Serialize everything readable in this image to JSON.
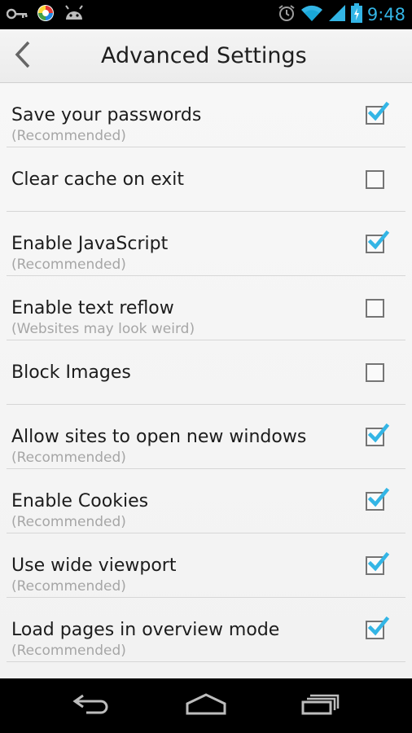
{
  "status_bar": {
    "time": "9:48",
    "icons": [
      "key-icon",
      "app-color-icon",
      "android-icon",
      "alarm-icon",
      "wifi-icon",
      "signal-icon",
      "battery-charging-icon"
    ]
  },
  "header": {
    "title": "Advanced Settings",
    "back_icon": "chevron-left-icon"
  },
  "settings": [
    {
      "label": "Save your passwords",
      "sub": "(Recommended)",
      "checked": true
    },
    {
      "label": "Clear cache on exit",
      "sub": "",
      "checked": false
    },
    {
      "label": "Enable JavaScript",
      "sub": "(Recommended)",
      "checked": true
    },
    {
      "label": "Enable text reflow",
      "sub": "(Websites may look weird)",
      "checked": false
    },
    {
      "label": "Block Images",
      "sub": "",
      "checked": false
    },
    {
      "label": "Allow sites to open new windows",
      "sub": "(Recommended)",
      "checked": true
    },
    {
      "label": "Enable Cookies",
      "sub": "(Recommended)",
      "checked": true
    },
    {
      "label": "Use wide viewport",
      "sub": "(Recommended)",
      "checked": true
    },
    {
      "label": "Load pages in overview mode",
      "sub": "(Recommended)",
      "checked": true
    }
  ],
  "nav_bar": {
    "icons": [
      "back-nav-icon",
      "home-nav-icon",
      "recent-apps-icon"
    ]
  },
  "colors": {
    "accent": "#33b5e5",
    "check": "#33b5e5"
  }
}
